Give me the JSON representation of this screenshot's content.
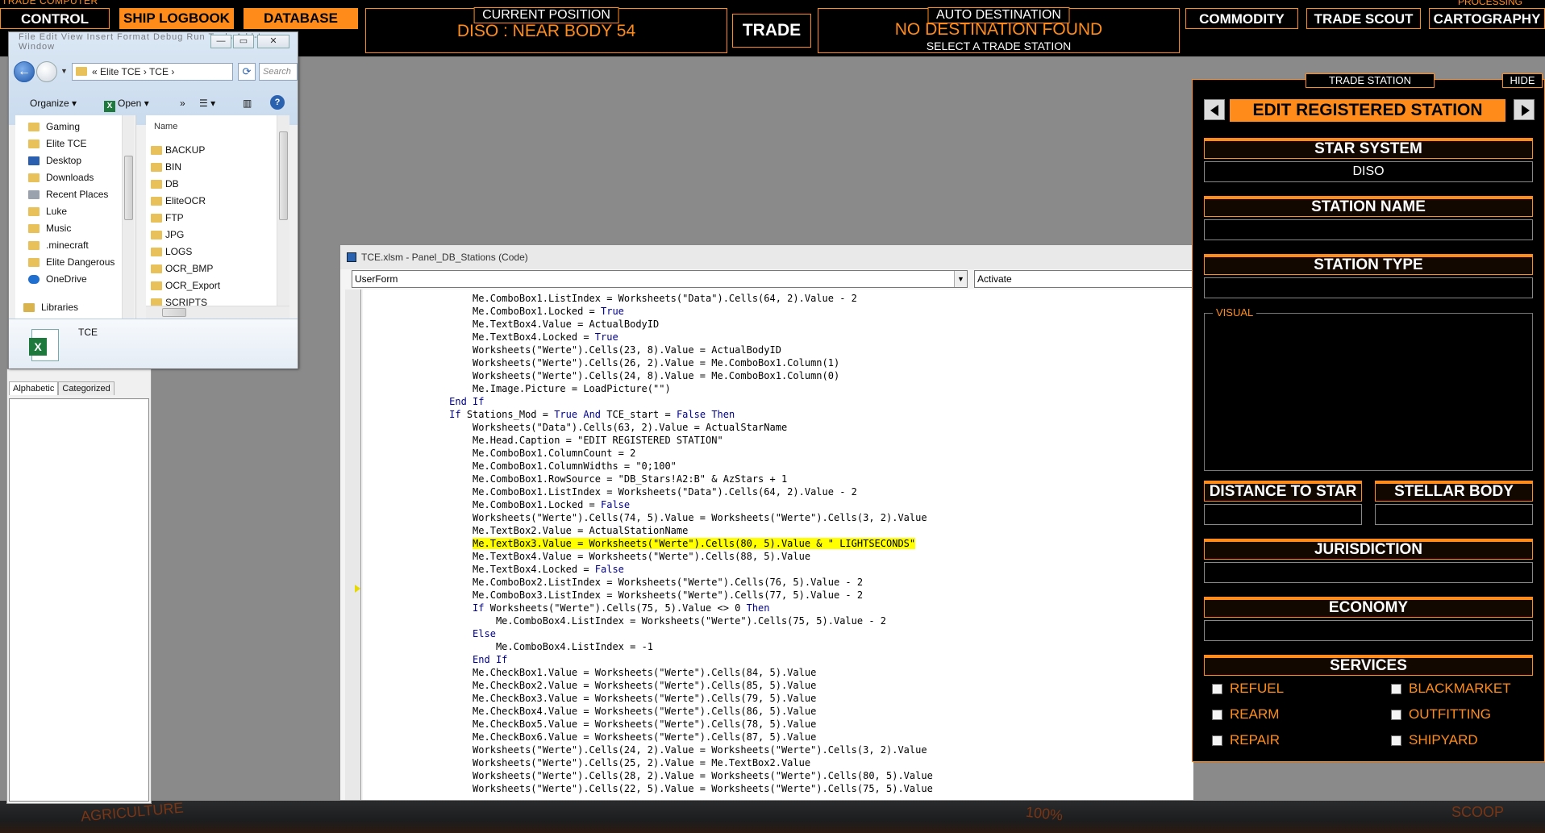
{
  "hud": {
    "app_title": "TRADE COMPUTER",
    "processing": "PROCESSING",
    "nav": [
      "CONTROL",
      "SHIP LOGBOOK",
      "DATABASE"
    ],
    "right_nav": [
      "COMMODITY",
      "TRADE SCOUT",
      "CARTOGRAPHY"
    ],
    "current_position_caption": "CURRENT POSITION",
    "current_position": "DISO : NEAR BODY 54",
    "trade_button": "TRADE",
    "auto_destination_caption": "AUTO DESTINATION",
    "auto_destination": "NO DESTINATION FOUND",
    "auto_destination_hint": "SELECT A TRADE STATION",
    "bottom_labels": [
      "AGRICULTURE",
      "100%",
      "SCOOP"
    ]
  },
  "explorer": {
    "menu": "File  Edit  View  Insert  Format  Debug  Run  Tools  Add-Ins  Window",
    "address": [
      "«",
      "Elite TCE",
      "›",
      "TCE",
      "›"
    ],
    "search_placeholder": "Search",
    "toolbar": {
      "organize": "Organize",
      "open": "Open",
      "more": "»"
    },
    "nav_items": [
      "Gaming",
      "Elite TCE",
      "Desktop",
      "Downloads",
      "Recent Places",
      "Luke",
      "Music",
      ".minecraft",
      "Elite Dangerous",
      "OneDrive",
      "Libraries"
    ],
    "column_header": "Name",
    "files": [
      "BACKUP",
      "BIN",
      "DB",
      "EliteOCR",
      "FTP",
      "JPG",
      "LOGS",
      "OCR_BMP",
      "OCR_Export",
      "SCRIPTS"
    ],
    "selected_file": "TCE"
  },
  "props": {
    "tabs": [
      "Alphabetic",
      "Categorized"
    ]
  },
  "code_window": {
    "title": "TCE.xlsm - Panel_DB_Stations (Code)",
    "object_combo": "UserForm",
    "proc_combo": "Activate",
    "lines": [
      {
        "i": 8,
        "t": "Me.ComboBox1.ListIndex = Worksheets(\"Data\").Cells(64, 2).Value - 2"
      },
      {
        "i": 8,
        "t": "Me.ComboBox1.Locked = True"
      },
      {
        "i": 8,
        "t": "Me.TextBox4.Value = ActualBodyID"
      },
      {
        "i": 8,
        "t": "Me.TextBox4.Locked = True"
      },
      {
        "i": 8,
        "t": "Worksheets(\"Werte\").Cells(23, 8).Value = ActualBodyID"
      },
      {
        "i": 8,
        "t": "Worksheets(\"Werte\").Cells(26, 2).Value = Me.ComboBox1.Column(1)"
      },
      {
        "i": 8,
        "t": "Worksheets(\"Werte\").Cells(24, 8).Value = Me.ComboBox1.Column(0)"
      },
      {
        "i": 8,
        "t": "Me.Image.Picture = LoadPicture(\"\")"
      },
      {
        "i": 4,
        "t": "End If"
      },
      {
        "i": 4,
        "t": "If Stations_Mod = True And TCE_start = False Then"
      },
      {
        "i": 8,
        "t": "Worksheets(\"Data\").Cells(63, 2).Value = ActualStarName"
      },
      {
        "i": 8,
        "t": "Me.Head.Caption = \"EDIT REGISTERED STATION\""
      },
      {
        "i": 8,
        "t": "Me.ComboBox1.ColumnCount = 2"
      },
      {
        "i": 8,
        "t": "Me.ComboBox1.ColumnWidths = \"0;100\""
      },
      {
        "i": 8,
        "t": "Me.ComboBox1.RowSource = \"DB_Stars!A2:B\" & AzStars + 1"
      },
      {
        "i": 8,
        "t": "Me.ComboBox1.ListIndex = Worksheets(\"Data\").Cells(64, 2).Value - 2"
      },
      {
        "i": 8,
        "t": "Me.ComboBox1.Locked = False"
      },
      {
        "i": 8,
        "t": "Worksheets(\"Werte\").Cells(74, 5).Value = Worksheets(\"Werte\").Cells(3, 2).Value"
      },
      {
        "i": 8,
        "t": "Me.TextBox2.Value = ActualStationName"
      },
      {
        "i": 8,
        "t": "Me.TextBox3.Value = Worksheets(\"Werte\").Cells(80, 5).Value & \" LIGHTSECONDS\"",
        "hl": true
      },
      {
        "i": 8,
        "t": "Me.TextBox4.Value = Worksheets(\"Werte\").Cells(88, 5).Value"
      },
      {
        "i": 8,
        "t": "Me.TextBox4.Locked = False"
      },
      {
        "i": 8,
        "t": "Me.ComboBox2.ListIndex = Worksheets(\"Werte\").Cells(76, 5).Value - 2"
      },
      {
        "i": 8,
        "t": "Me.ComboBox3.ListIndex = Worksheets(\"Werte\").Cells(77, 5).Value - 2"
      },
      {
        "i": 8,
        "t": "If Worksheets(\"Werte\").Cells(75, 5).Value <> 0 Then"
      },
      {
        "i": 12,
        "t": "Me.ComboBox4.ListIndex = Worksheets(\"Werte\").Cells(75, 5).Value - 2"
      },
      {
        "i": 8,
        "t": "Else"
      },
      {
        "i": 12,
        "t": "Me.ComboBox4.ListIndex = -1"
      },
      {
        "i": 8,
        "t": "End If"
      },
      {
        "i": 8,
        "t": "Me.CheckBox1.Value = Worksheets(\"Werte\").Cells(84, 5).Value"
      },
      {
        "i": 8,
        "t": "Me.CheckBox2.Value = Worksheets(\"Werte\").Cells(85, 5).Value"
      },
      {
        "i": 8,
        "t": "Me.CheckBox3.Value = Worksheets(\"Werte\").Cells(79, 5).Value"
      },
      {
        "i": 8,
        "t": "Me.CheckBox4.Value = Worksheets(\"Werte\").Cells(86, 5).Value"
      },
      {
        "i": 8,
        "t": "Me.CheckBox5.Value = Worksheets(\"Werte\").Cells(78, 5).Value"
      },
      {
        "i": 8,
        "t": "Me.CheckBox6.Value = Worksheets(\"Werte\").Cells(87, 5).Value"
      },
      {
        "i": 8,
        "t": "Worksheets(\"Werte\").Cells(24, 2).Value = Worksheets(\"Werte\").Cells(3, 2).Value"
      },
      {
        "i": 8,
        "t": "Worksheets(\"Werte\").Cells(25, 2).Value = Me.TextBox2.Value"
      },
      {
        "i": 8,
        "t": "Worksheets(\"Werte\").Cells(28, 2).Value = Worksheets(\"Werte\").Cells(80, 5).Value"
      },
      {
        "i": 8,
        "t": "Worksheets(\"Werte\").Cells(22, 5).Value = Worksheets(\"Werte\").Cells(75, 5).Value"
      }
    ]
  },
  "station": {
    "header": "TRADE STATION",
    "hide": "HIDE",
    "title": "EDIT REGISTERED STATION",
    "star_system_label": "STAR SYSTEM",
    "star_system_value": "DISO",
    "station_name_label": "STATION NAME",
    "station_name_value": "",
    "station_type_label": "STATION TYPE",
    "station_type_value": "",
    "visual_label": "VISUAL",
    "distance_label": "DISTANCE TO STAR",
    "distance_value": "",
    "body_label": "STELLAR BODY",
    "body_value": "",
    "jurisdiction_label": "JURISDICTION",
    "jurisdiction_value": "",
    "economy_label": "ECONOMY",
    "economy_value": "",
    "services_label": "SERVICES",
    "services": [
      "REFUEL",
      "BLACKMARKET",
      "REARM",
      "OUTFITTING",
      "REPAIR",
      "SHIPYARD"
    ]
  },
  "colors": {
    "accent": "#ff8c1a",
    "highlight": "#ffff00",
    "keyword": "#00008b"
  }
}
